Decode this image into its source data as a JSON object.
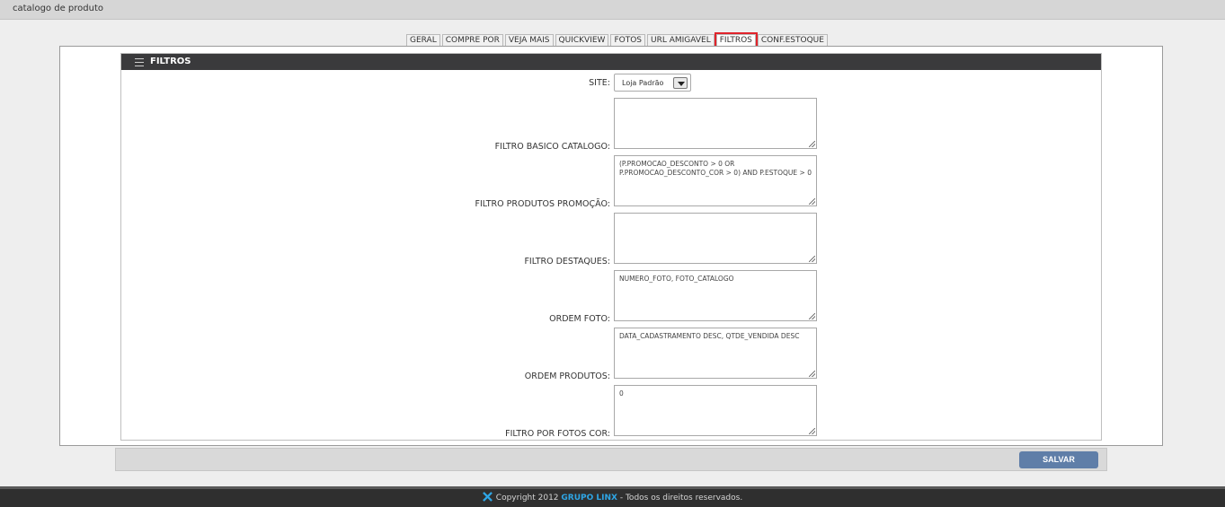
{
  "app": {
    "title": "catalogo de produto"
  },
  "tabs": [
    {
      "label": "GERAL"
    },
    {
      "label": "COMPRE POR"
    },
    {
      "label": "VEJA MAIS"
    },
    {
      "label": "QUICKVIEW"
    },
    {
      "label": "FOTOS"
    },
    {
      "label": "URL AMIGAVEL"
    },
    {
      "label": "FILTROS",
      "active": true
    },
    {
      "label": "CONF.ESTOQUE"
    }
  ],
  "panel": {
    "title": "FILTROS",
    "site": {
      "label": "SITE:",
      "value": "Loja Padrão"
    },
    "fields": [
      {
        "label": "FILTRO BASICO CATALOGO:",
        "value": ""
      },
      {
        "label": "FILTRO PRODUTOS PROMOÇÃO:",
        "value": "(P.PROMOCAO_DESCONTO > 0 OR P.PROMOCAO_DESCONTO_COR > 0) AND P.ESTOQUE > 0"
      },
      {
        "label": "FILTRO DESTAQUES:",
        "value": ""
      },
      {
        "label": "ORDEM FOTO:",
        "value": "NUMERO_FOTO, FOTO_CATALOGO"
      },
      {
        "label": "ORDEM PRODUTOS:",
        "value": "DATA_CADASTRAMENTO DESC, QTDE_VENDIDA DESC"
      },
      {
        "label": "FILTRO POR FOTOS COR:",
        "value": "0"
      }
    ]
  },
  "actions": {
    "save_label": "SALVAR"
  },
  "footer": {
    "prefix": "Copyright 2012",
    "brand": "GRUPO LINX",
    "suffix": "- Todos os direitos reservados."
  },
  "colors": {
    "header_dark": "#3a3a3c",
    "active_tab_outline": "#e0242b",
    "save_button": "#5f7ea8",
    "brand_blue": "#2ea6e6"
  }
}
